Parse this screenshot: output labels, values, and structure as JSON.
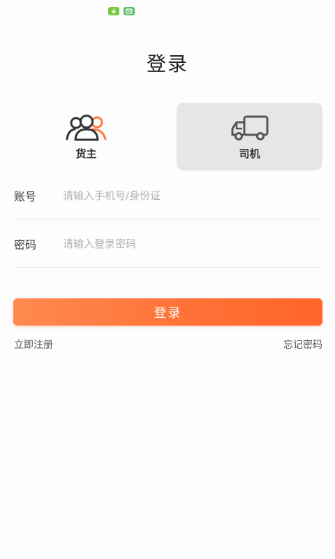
{
  "page": {
    "title": "登录"
  },
  "roles": [
    {
      "label": "货主",
      "icon": "users-icon",
      "selected": false
    },
    {
      "label": "司机",
      "icon": "truck-icon",
      "selected": true
    }
  ],
  "form": {
    "account": {
      "label": "账号",
      "placeholder": "请输入手机号/身份证",
      "value": ""
    },
    "password": {
      "label": "密码",
      "placeholder": "请输入登录密码",
      "value": ""
    }
  },
  "buttons": {
    "login": "登录"
  },
  "links": {
    "register": "立即注册",
    "forgot": "忘记密码"
  },
  "colors": {
    "accent": "#ff7035",
    "selected_card_bg": "#e6e6e6",
    "status_icon": "#7ac943"
  }
}
